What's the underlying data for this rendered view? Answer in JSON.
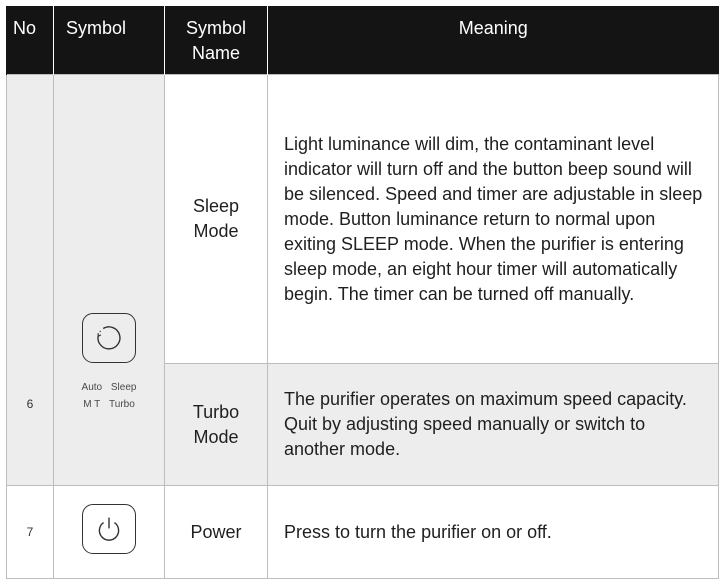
{
  "table": {
    "headers": {
      "no": "No",
      "symbol": "Symbol",
      "symbol_name": "Symbol Name",
      "meaning": "Meaning"
    },
    "rows": [
      {
        "no": "6",
        "symbol_icon": "mode-cycle-icon",
        "symbol_labels_line1": [
          "Auto",
          "Sleep"
        ],
        "symbol_labels_line2": [
          "M T",
          "Turbo"
        ],
        "modes": [
          {
            "name": "Sleep Mode",
            "meaning": "Light luminance will dim, the contaminant level indicator will turn off and the button beep sound will be silenced. Speed and timer are adjustable in sleep mode. Button luminance return to normal upon exiting SLEEP mode. When the purifier is entering sleep mode, an eight hour timer will automatically begin. The timer can be turned off manually."
          },
          {
            "name": "Turbo Mode",
            "meaning": "The purifier operates on maximum speed capacity. Quit by adjusting speed manually or switch to another mode."
          }
        ]
      },
      {
        "no": "7",
        "symbol_icon": "power-icon",
        "name": "Power",
        "meaning": "Press to turn the purifier on or off."
      }
    ]
  },
  "colors": {
    "header_bg": "#141414",
    "header_text": "#ffffff",
    "shaded_cell": "#ededed",
    "border": "#bdbdbd"
  }
}
